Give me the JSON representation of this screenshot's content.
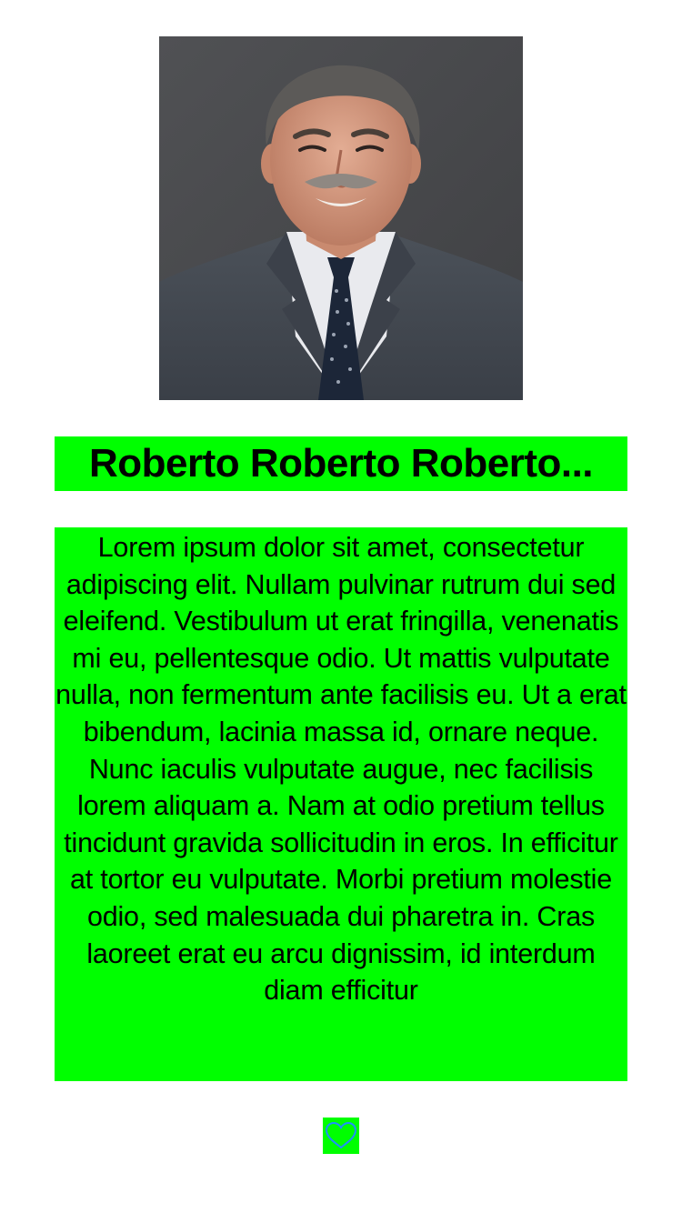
{
  "profile": {
    "photo_alt": "portrait-photo",
    "name": "Roberto Roberto Roberto...",
    "bio": "Lorem ipsum dolor sit amet, consectetur adipiscing elit. Nullam pulvinar rutrum dui sed eleifend. Vestibulum ut erat fringilla, venenatis mi eu, pellentesque odio. Ut mattis vulputate nulla, non fermentum ante facilisis eu. Ut a erat bibendum, lacinia massa id, ornare neque. Nunc iaculis vulputate augue, nec facilisis lorem aliquam a. Nam at odio pretium tellus tincidunt gravida sollicitudin in eros. In efficitur at tortor eu vulputate. Morbi pretium molestie odio, sed malesuada dui pharetra in. Cras laoreet erat eu arcu dignissim, id interdum diam efficitur"
  },
  "like": {
    "icon": "heart-outline-icon"
  },
  "colors": {
    "highlight": "#00ff00",
    "heart_stroke": "#1f8fff",
    "background": "#ffffff"
  }
}
